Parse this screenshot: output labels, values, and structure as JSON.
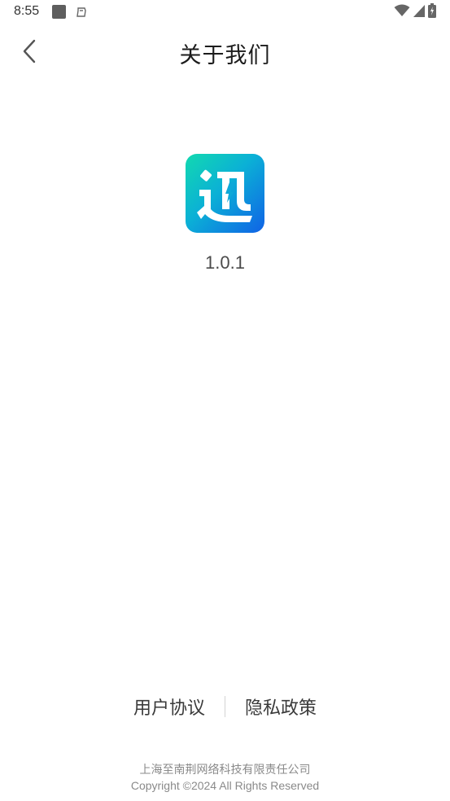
{
  "status_bar": {
    "time": "8:55"
  },
  "header": {
    "title": "关于我们"
  },
  "app": {
    "logo_text": "迅",
    "version": "1.0.1"
  },
  "footer": {
    "user_agreement": "用户协议",
    "privacy_policy": "隐私政策",
    "company": "上海至南荆网络科技有限责任公司",
    "copyright": "Copyright ©2024 All Rights Reserved"
  },
  "colors": {
    "logo_gradient_start": "#12d9b0",
    "logo_gradient_end": "#1062e6"
  }
}
